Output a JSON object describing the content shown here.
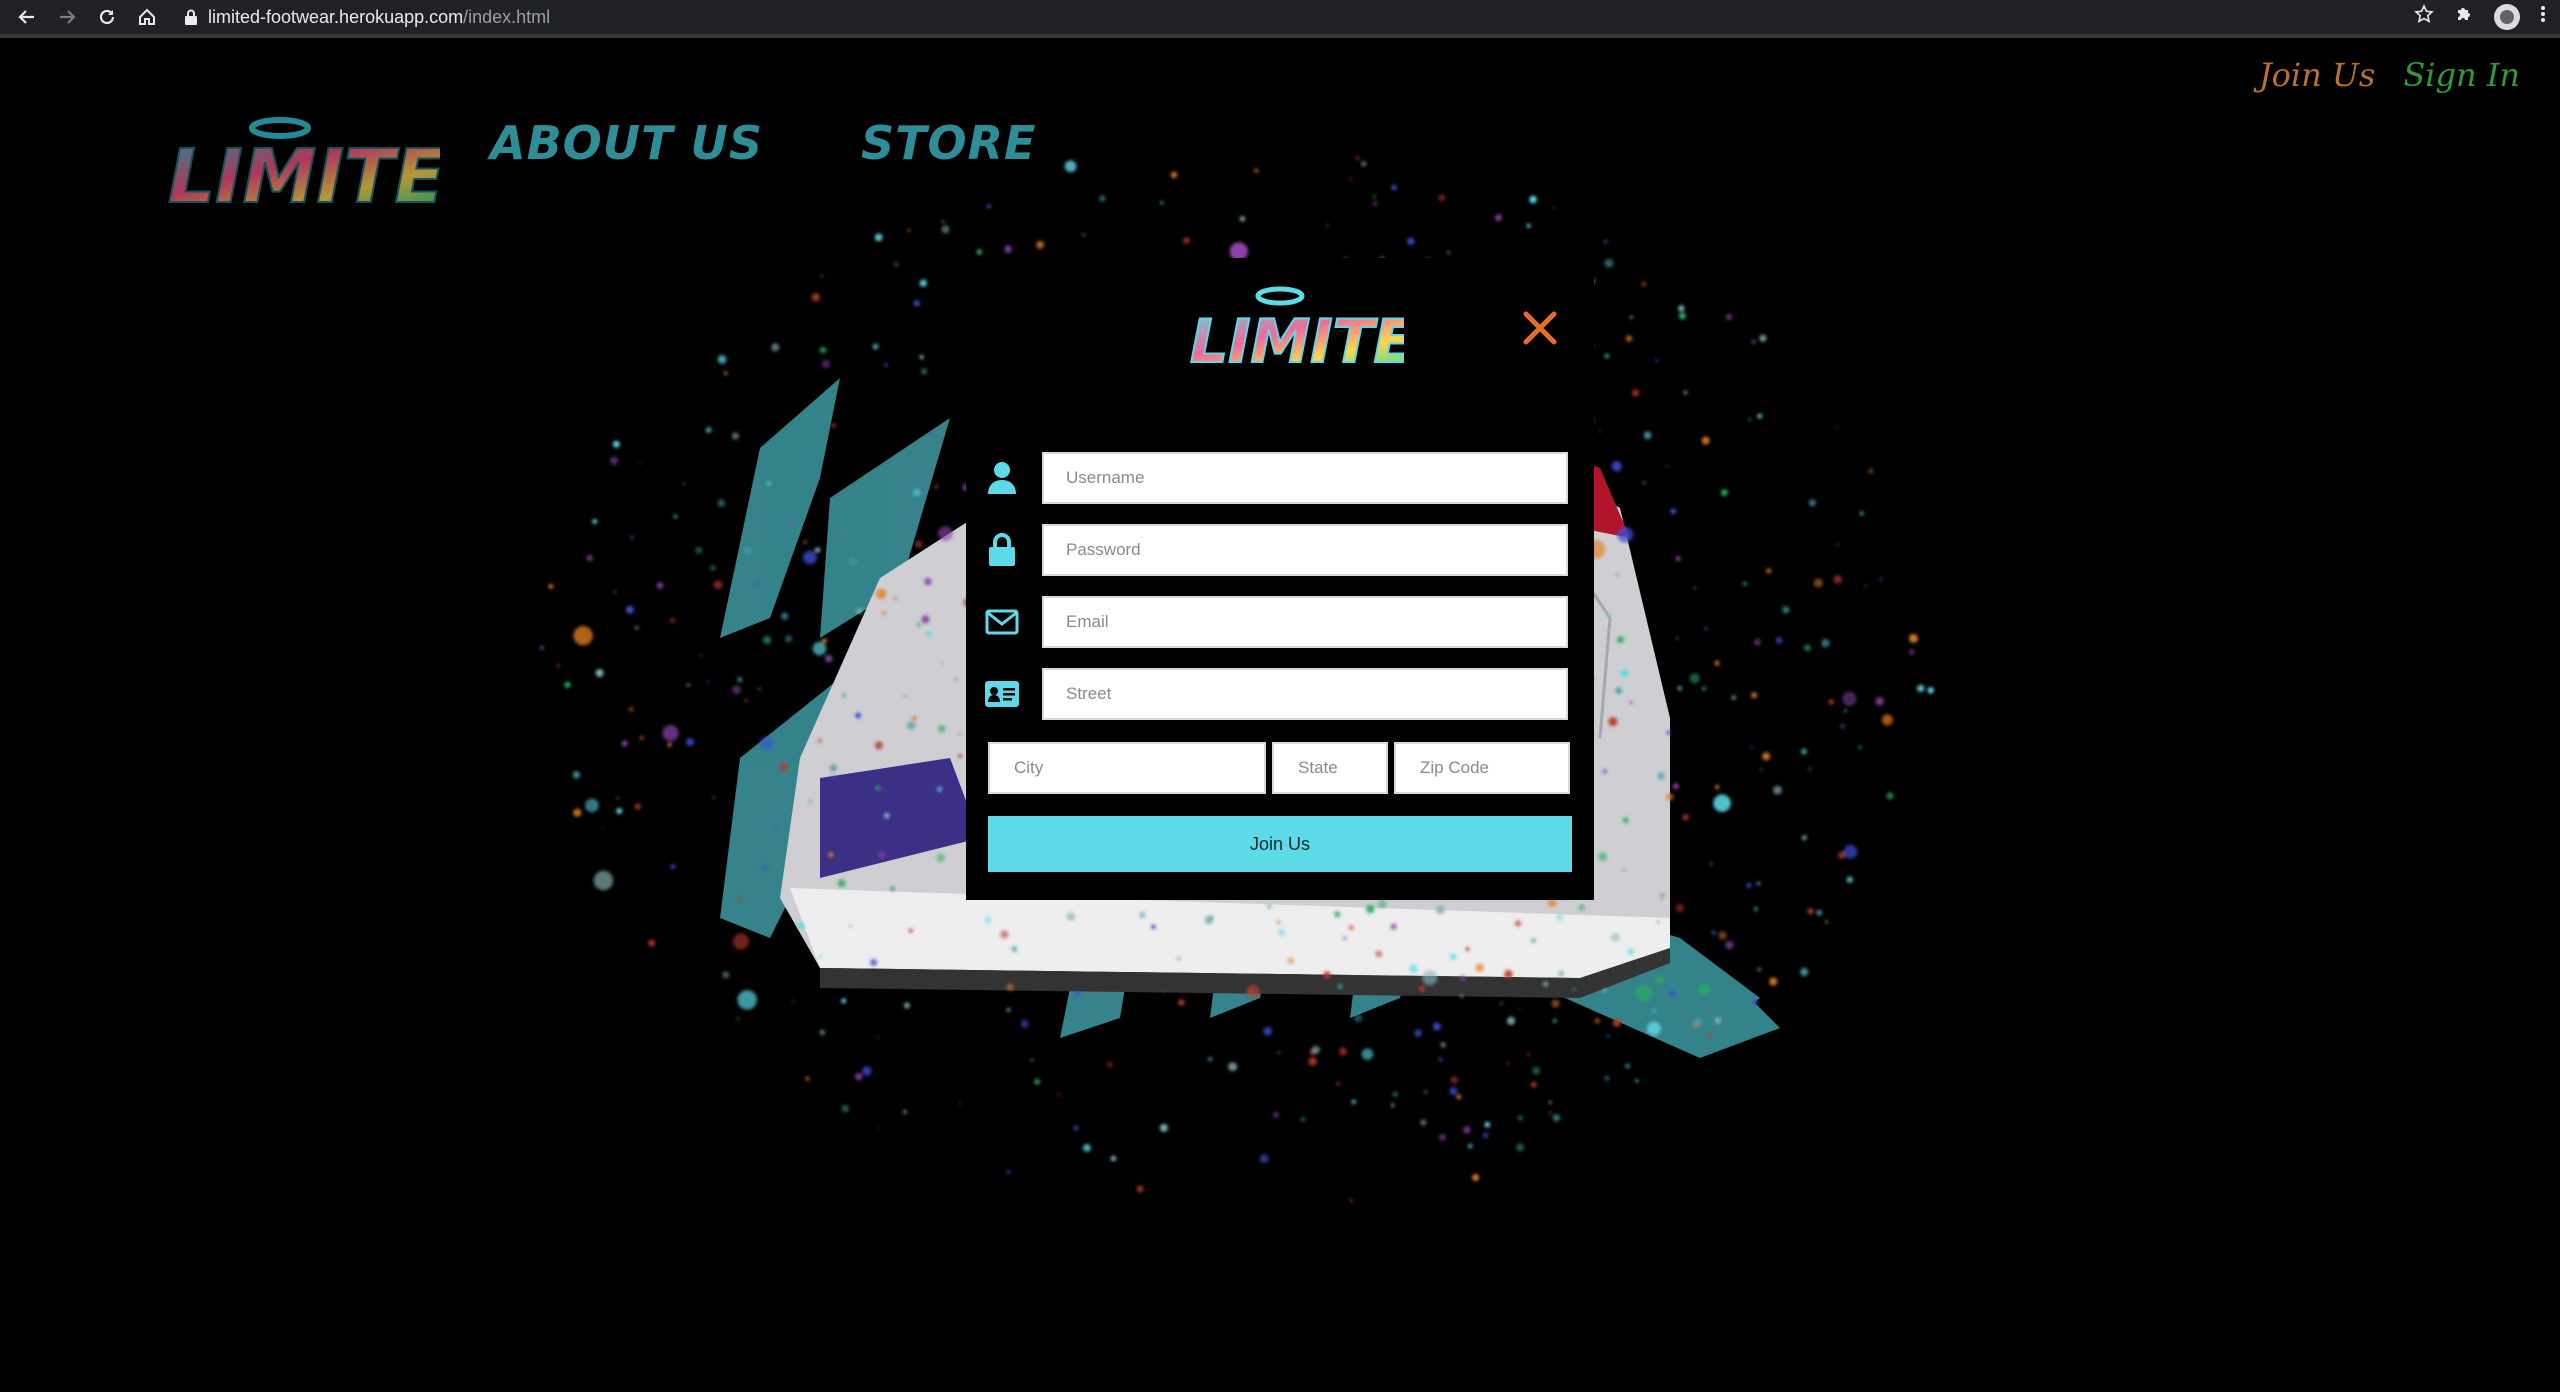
{
  "browser": {
    "url_host": "limited-footwear.herokuapp.com",
    "url_path": "/index.html"
  },
  "header": {
    "join_link": "Join Us",
    "signin_link": "Sign In",
    "nav": {
      "about": "ABOUT US",
      "store": "STORE"
    },
    "logo_text": "LIMITED"
  },
  "modal": {
    "logo_text": "LIMITED",
    "fields": {
      "username_placeholder": "Username",
      "password_placeholder": "Password",
      "email_placeholder": "Email",
      "street_placeholder": "Street",
      "city_placeholder": "City",
      "state_placeholder": "State",
      "zip_placeholder": "Zip Code"
    },
    "submit_label": "Join Us"
  },
  "colors": {
    "accent": "#5ed9e8",
    "close": "#e2702b",
    "nav": "#2e8d96",
    "join_link": "#b8722b",
    "signin_link": "#2f9a3a"
  },
  "icons": {
    "back": "arrow-left-icon",
    "forward": "arrow-right-icon",
    "reload": "reload-icon",
    "home": "home-icon",
    "lock": "lock-icon",
    "star": "star-icon",
    "extensions": "puzzle-icon",
    "username": "user-icon",
    "password": "lock-icon",
    "email": "envelope-icon",
    "street": "address-card-icon",
    "close": "close-icon"
  }
}
